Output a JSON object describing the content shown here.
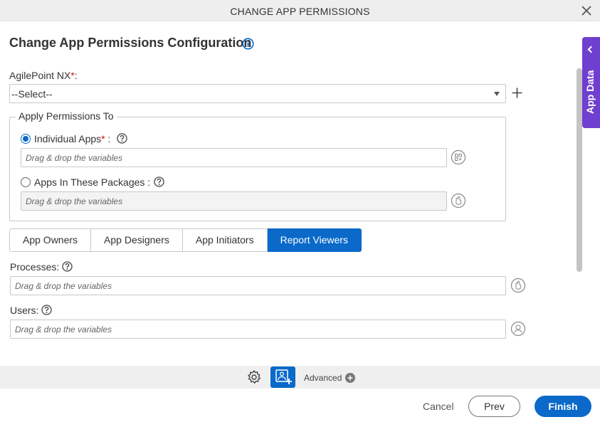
{
  "dialog": {
    "title": "CHANGE APP PERMISSIONS",
    "heading": "Change App Permissions Configuration"
  },
  "agilepoint": {
    "label": "AgilePoint NX",
    "required_mark": "*",
    "colon": ":",
    "selected": "--Select--"
  },
  "apply_permissions": {
    "legend": "Apply Permissions To",
    "individual_apps": {
      "label": "Individual Apps",
      "required_mark": "*",
      "suffix": " :",
      "selected": true,
      "placeholder": "Drag & drop the variables"
    },
    "packages": {
      "label": "Apps In These Packages :",
      "selected": false,
      "placeholder": "Drag & drop the variables"
    }
  },
  "tabs": [
    {
      "label": "App Owners",
      "active": false
    },
    {
      "label": "App Designers",
      "active": false
    },
    {
      "label": "App Initiators",
      "active": false
    },
    {
      "label": "Report Viewers",
      "active": true
    }
  ],
  "processes": {
    "label": "Processes:",
    "placeholder": "Drag & drop the variables"
  },
  "users": {
    "label": "Users:",
    "placeholder": "Drag & drop the variables"
  },
  "side_panel": {
    "label": "App Data"
  },
  "toolbar": {
    "advanced_label": "Advanced"
  },
  "footer": {
    "cancel": "Cancel",
    "prev": "Prev",
    "finish": "Finish"
  },
  "colors": {
    "accent": "#0a69c9",
    "side_panel": "#6f3fd0",
    "required": "#e0001b"
  }
}
